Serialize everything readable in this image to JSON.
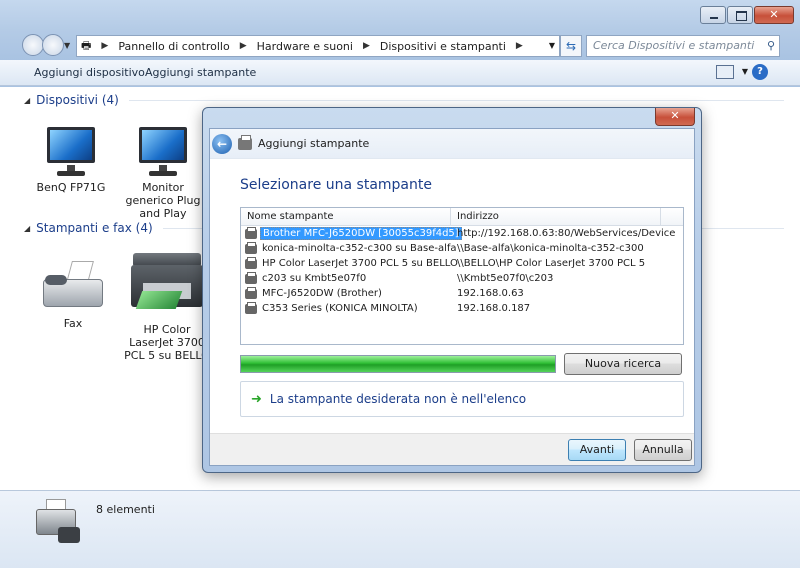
{
  "explorer": {
    "breadcrumb": [
      "Pannello di controllo",
      "Hardware e suoni",
      "Dispositivi e stampanti"
    ],
    "search_placeholder": "Cerca Dispositivi e stampanti",
    "toolbar": {
      "add_device": "Aggiungi dispositivo",
      "add_printer": "Aggiungi stampante",
      "help": "?"
    },
    "groups": {
      "devices": {
        "title": "Dispositivi (4)",
        "items": [
          "BenQ FP71G",
          "Monitor generico Plug and Play"
        ]
      },
      "printers": {
        "title": "Stampanti e fax (4)",
        "items": [
          "Fax",
          "HP Color LaserJet 3700 PCL 5 su BELLO"
        ]
      }
    },
    "status_count": "8 elementi"
  },
  "dialog": {
    "title": "Aggiungi stampante",
    "heading": "Selezionare una stampante",
    "columns": [
      "Nome stampante",
      "Indirizzo"
    ],
    "printers": [
      {
        "name": "Brother MFC-J6520DW [30055c39f4d5]",
        "address": "http://192.168.0.63:80/WebServices/Device",
        "selected": true
      },
      {
        "name": "konica-minolta-c352-c300 su Base-alfa",
        "address": "\\\\Base-alfa\\konica-minolta-c352-c300",
        "selected": false
      },
      {
        "name": "HP Color LaserJet 3700 PCL 5 su BELLO",
        "address": "\\\\BELLO\\HP Color LaserJet 3700 PCL 5",
        "selected": false
      },
      {
        "name": "c203 su Kmbt5e07f0",
        "address": "\\\\Kmbt5e07f0\\c203",
        "selected": false
      },
      {
        "name": "MFC-J6520DW (Brother)",
        "address": "192.168.0.63",
        "selected": false
      },
      {
        "name": "C353 Series (KONICA MINOLTA)",
        "address": "192.168.0.187",
        "selected": false
      }
    ],
    "progress": 1.0,
    "search_again": "Nuova ricerca",
    "not_listed": "La stampante desiderata non è nell'elenco",
    "next": "Avanti",
    "cancel": "Annulla",
    "close_glyph": "✕"
  },
  "colors": {
    "accent": "#1c3e8a",
    "selection": "#3399ff",
    "progress": "#2fbf35",
    "close": "#c7503a"
  }
}
